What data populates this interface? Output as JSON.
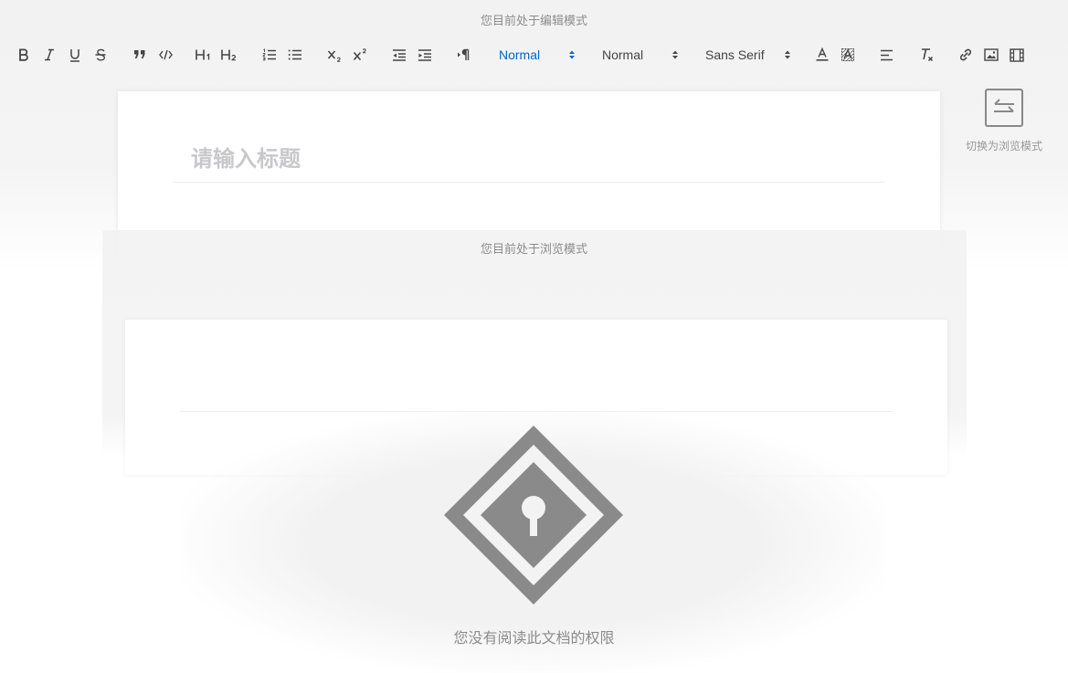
{
  "edit_mode": {
    "label": "您目前处于编辑模式"
  },
  "toolbar": {
    "buttons": [
      {
        "name": "bold-button",
        "icon": "bold-icon"
      },
      {
        "name": "italic-button",
        "icon": "italic-icon"
      },
      {
        "name": "underline-button",
        "icon": "underline-icon"
      },
      {
        "name": "strike-button",
        "icon": "strikethrough-icon"
      },
      {
        "name": "blockquote-button",
        "icon": "quote-icon"
      },
      {
        "name": "code-block-button",
        "icon": "code-icon"
      },
      {
        "name": "header-1-button",
        "icon": "h1-icon"
      },
      {
        "name": "header-2-button",
        "icon": "h2-icon"
      },
      {
        "name": "ordered-list-button",
        "icon": "ordered-list-icon"
      },
      {
        "name": "bullet-list-button",
        "icon": "bullet-list-icon"
      },
      {
        "name": "subscript-button",
        "icon": "subscript-icon"
      },
      {
        "name": "superscript-button",
        "icon": "superscript-icon"
      },
      {
        "name": "outdent-button",
        "icon": "outdent-icon"
      },
      {
        "name": "indent-button",
        "icon": "indent-icon"
      },
      {
        "name": "direction-button",
        "icon": "text-direction-icon"
      },
      {
        "name": "font-color-button",
        "icon": "font-color-icon"
      },
      {
        "name": "background-color-button",
        "icon": "background-color-icon"
      },
      {
        "name": "align-button",
        "icon": "align-left-icon"
      },
      {
        "name": "clear-format-button",
        "icon": "clear-format-icon"
      },
      {
        "name": "link-button",
        "icon": "link-icon"
      },
      {
        "name": "image-button",
        "icon": "image-icon"
      },
      {
        "name": "video-button",
        "icon": "video-icon"
      }
    ],
    "header_select": "Normal",
    "size_select": "Normal",
    "font_select": "Sans Serif",
    "active_color": "#06c"
  },
  "editor": {
    "title_placeholder": "请输入标题"
  },
  "switch_mode": {
    "label": "切换为浏览模式",
    "icon": "switch-arrows-icon"
  },
  "view_mode": {
    "label": "您目前处于浏览模式"
  },
  "permission": {
    "message": "您没有阅读此文档的权限",
    "icon": "lock-diamond-icon"
  }
}
